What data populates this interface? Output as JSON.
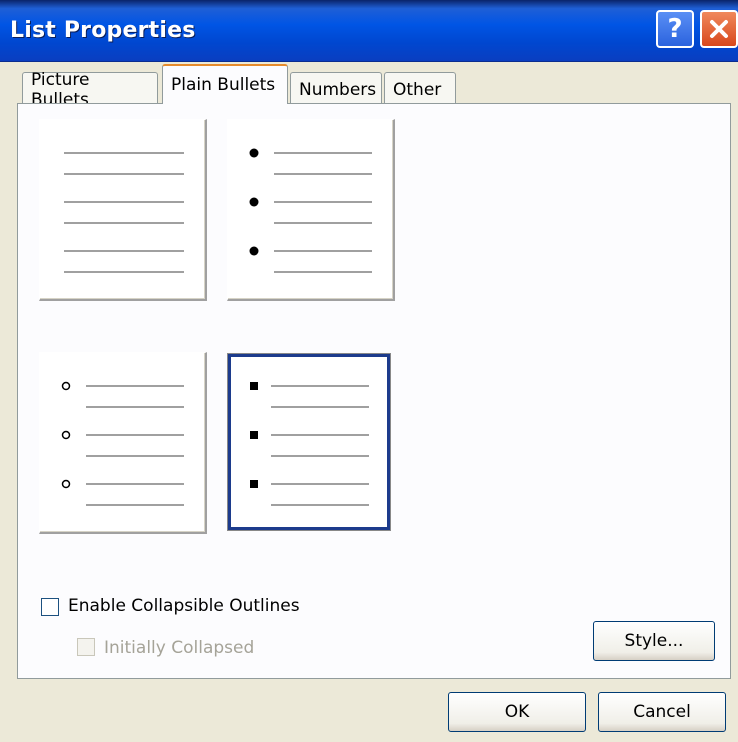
{
  "window": {
    "title": "List Properties",
    "help_glyph": "?",
    "titlebar_color": "#0055e5",
    "close_color": "#d8481c"
  },
  "tabs": [
    {
      "label": "Picture Bullets",
      "active": false
    },
    {
      "label": "Plain Bullets",
      "active": true
    },
    {
      "label": "Numbers",
      "active": false
    },
    {
      "label": "Other",
      "active": false
    }
  ],
  "bullet_styles": [
    {
      "style": "none",
      "selected": false
    },
    {
      "style": "filled-circle",
      "selected": false
    },
    {
      "style": "hollow-circle",
      "selected": false
    },
    {
      "style": "filled-square",
      "selected": true
    }
  ],
  "options": {
    "enable_collapsible_label": "Enable Collapsible Outlines",
    "enable_collapsible_checked": false,
    "initially_collapsed_label": "Initially Collapsed",
    "initially_collapsed_checked": false,
    "initially_collapsed_enabled": false
  },
  "buttons": {
    "style": "Style...",
    "ok": "OK",
    "cancel": "Cancel"
  }
}
